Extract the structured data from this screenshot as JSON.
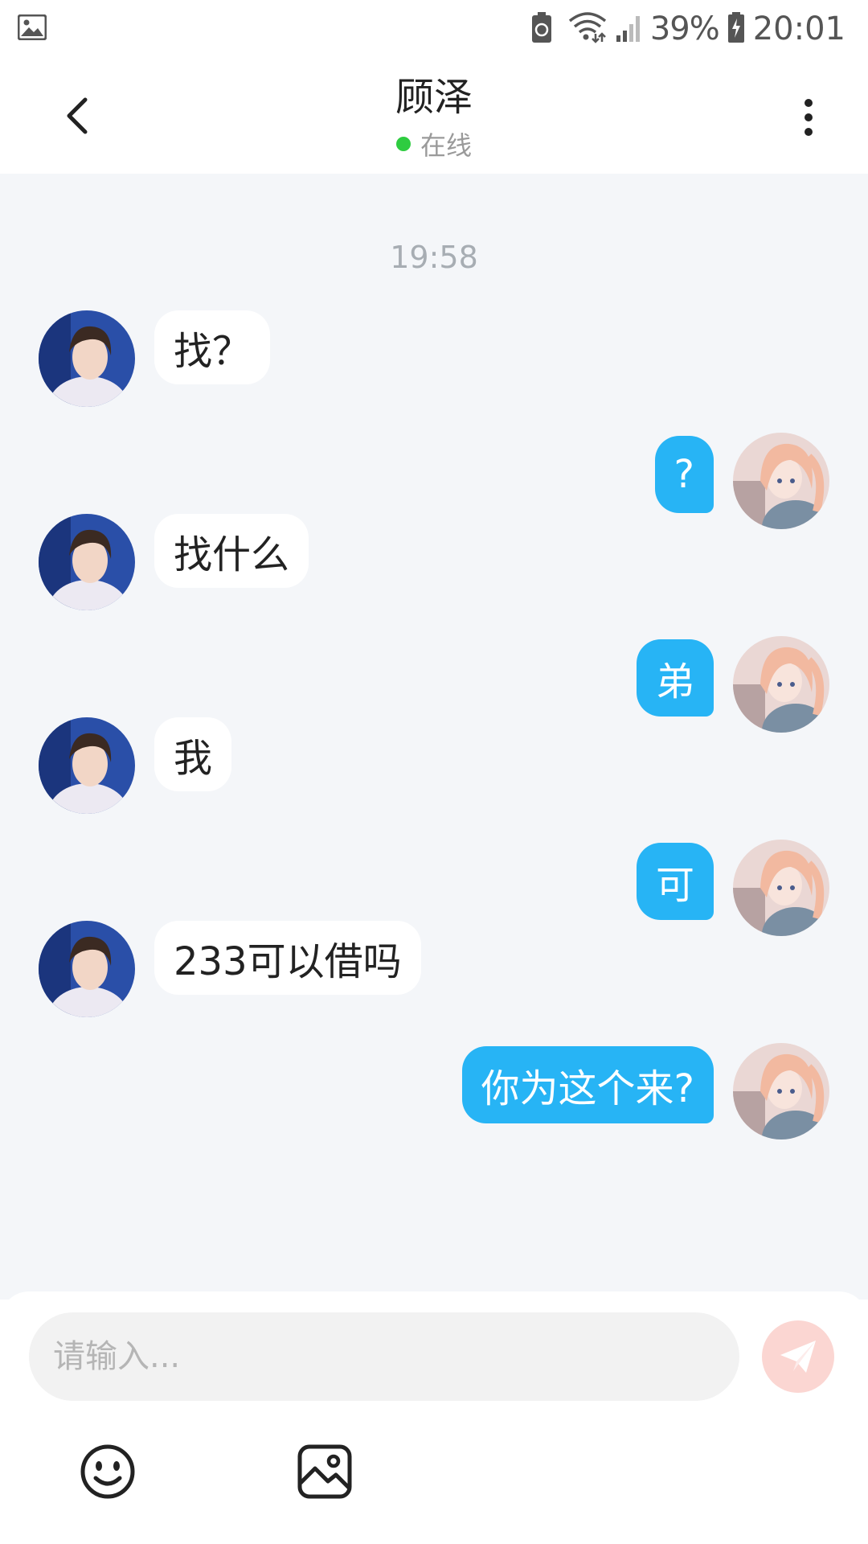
{
  "status_bar": {
    "battery_percent": "39%",
    "time": "20:01",
    "icons": [
      "gallery-icon",
      "battery-saver-icon",
      "wifi-icon",
      "signal-icon",
      "battery-icon"
    ]
  },
  "header": {
    "title": "顾泽",
    "status": "在线",
    "status_color": "#2ecc40",
    "back_icon": "chevron-left-icon",
    "menu_icon": "more-vertical-icon"
  },
  "chat": {
    "timestamp": "19:58",
    "messages": [
      {
        "side": "left",
        "text": "找？"
      },
      {
        "side": "right",
        "text": "?"
      },
      {
        "side": "left",
        "text": "找什么"
      },
      {
        "side": "right",
        "text": "弟"
      },
      {
        "side": "left",
        "text": "我"
      },
      {
        "side": "right",
        "text": "可"
      },
      {
        "side": "left",
        "text": "233可以借吗"
      },
      {
        "side": "right",
        "text": "你为这个来?"
      }
    ]
  },
  "input": {
    "placeholder": "请输入...",
    "value": "",
    "send_icon": "paper-plane-icon",
    "tools": [
      "emoji-icon",
      "image-icon"
    ]
  },
  "colors": {
    "bubble_outgoing": "#27b4f5",
    "bubble_incoming": "#ffffff",
    "chat_background": "#f4f6f9",
    "send_button": "#fbd6d2"
  }
}
